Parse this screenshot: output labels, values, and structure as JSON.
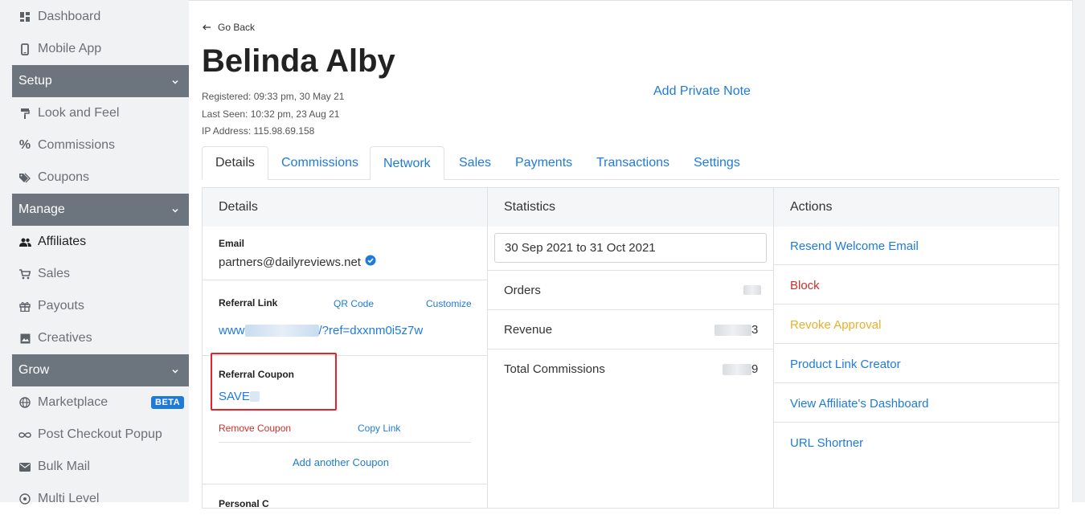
{
  "sidebar": {
    "dashboard": "Dashboard",
    "mobile_app": "Mobile App",
    "setup": "Setup",
    "look_and_feel": "Look and Feel",
    "commissions": "Commissions",
    "coupons": "Coupons",
    "manage": "Manage",
    "affiliates": "Affiliates",
    "sales": "Sales",
    "payouts": "Payouts",
    "creatives": "Creatives",
    "grow": "Grow",
    "marketplace": "Marketplace",
    "beta": "BETA",
    "post_checkout_popup": "Post Checkout Popup",
    "bulk_mail": "Bulk Mail",
    "multi_level": "Multi Level"
  },
  "header": {
    "go_back": "Go Back",
    "name": "Belinda Alby",
    "registered": "Registered: 09:33 pm, 30 May 21",
    "last_seen": "Last Seen: 10:32 pm, 23 Aug 21",
    "ip_address": "IP Address: 115.98.69.158",
    "add_note": "Add Private Note"
  },
  "tabs": [
    "Details",
    "Commissions",
    "Network",
    "Sales",
    "Payments",
    "Transactions",
    "Settings"
  ],
  "details": {
    "title": "Details",
    "email_label": "Email",
    "email_value": "partners@dailyreviews.net",
    "referral_link_label": "Referral Link",
    "qr_code": "QR Code",
    "customize": "Customize",
    "referral_link_prefix": "www",
    "referral_link_suffix": "/?ref=dxxnm0i5z7w",
    "referral_coupon_label": "Referral Coupon",
    "coupon_code": "SAVE",
    "remove_coupon": "Remove Coupon",
    "copy_link": "Copy Link",
    "add_coupon": "Add another Coupon",
    "next_label": "Personal C"
  },
  "statistics": {
    "title": "Statistics",
    "date_range": "30 Sep 2021 to 31 Oct 2021",
    "orders": "Orders",
    "revenue": "Revenue",
    "revenue_tail": "3",
    "total_commissions": "Total Commissions",
    "commissions_tail": "9"
  },
  "actions": {
    "title": "Actions",
    "resend_email": "Resend Welcome Email",
    "block": "Block",
    "revoke": "Revoke Approval",
    "product_link": "Product Link Creator",
    "view_dashboard": "View Affiliate's Dashboard",
    "url_shortner": "URL Shortner"
  },
  "colors": {
    "link": "#1f7bd8",
    "danger": "#c9302c",
    "warning": "#e5b22b",
    "highlight": "#e3242b",
    "section": "#6c757d"
  }
}
